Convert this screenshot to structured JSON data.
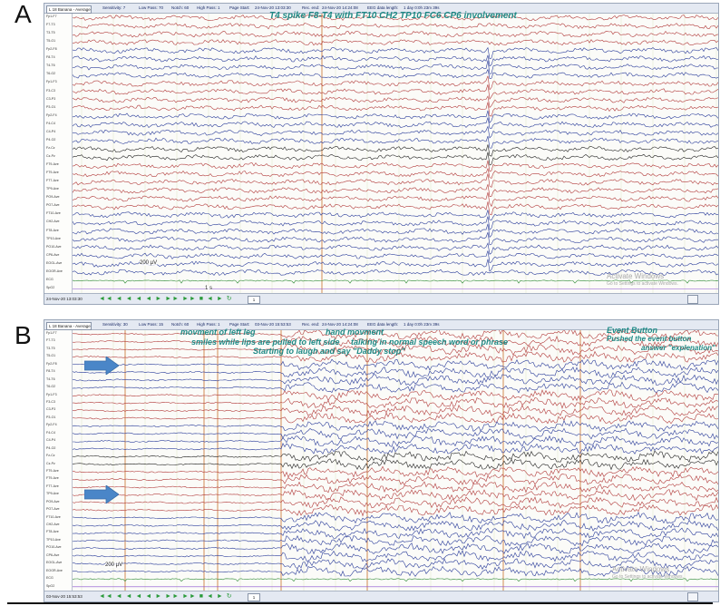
{
  "panels": [
    {
      "letter": "A",
      "toolbar": {
        "montage": "L 18 Banana - Average",
        "sensitivity": "Sensitivity: 7",
        "low_pass": "Low Pass: 70",
        "notch": "Notch: 60",
        "high_pass": "High Pass: 1",
        "page_start": "Page Start:",
        "start_time": "24-Nov-20 13:03:30",
        "rec_end": "Rec. end:",
        "end_time": "24-Nov-20 14:24:08",
        "data_length": "EEG data length:",
        "duration": "1 day 0:0h 23m 39s"
      },
      "channels": [
        "Fp1-F7",
        "F7-T3",
        "T3-T5",
        "T5-O1",
        "Fp2-F8",
        "F8-T4",
        "T4-T6",
        "T6-O2",
        "Fp1-F3",
        "F3-C3",
        "C3-P3",
        "P3-O1",
        "Fp2-F4",
        "F4-C4",
        "C4-P4",
        "P4-O2",
        "Fz-Cz",
        "Cz-Pz",
        "FT9-Ave",
        "FT9-Ave",
        "FT7-Ave",
        "TP9-Ave",
        "PO9-Ave",
        "PO7-Ave",
        "FT10-Ave",
        "CH2-Ave",
        "FT8-Ave",
        "TP10-Ave",
        "PO10-Ave",
        "CP6-Ave",
        "EOGL-Ave",
        "EOGR-Ave",
        "ECG",
        "SpO2"
      ],
      "annotation": "T4 spike F8-T4 with FT10 CH2 TP10 FC6 CP6 involvement",
      "scale": "200 µV",
      "time_scale": "1 s",
      "watermark_title": "Activate Windows",
      "watermark_sub": "Go to Settings to activate Windows.",
      "status_time": "24-Nov-20 13:03:30",
      "page_value": "1"
    },
    {
      "letter": "B",
      "toolbar": {
        "montage": "L 18 Banana - Average",
        "sensitivity": "Sensitivity: 30",
        "low_pass": "Low Pass: 15",
        "notch": "Notch: 60",
        "high_pass": "High Pass: 1",
        "page_start": "Page Start:",
        "start_time": "03-Nov-20 15:53:53",
        "rec_end": "Rec. end:",
        "end_time": "24-Nov-20 14:24:08",
        "data_length": "EEG data length:",
        "duration": "1 day 0:0h 23m 39s"
      },
      "channels": [
        "Fp1-F7",
        "F7-T3",
        "T3-T5",
        "T5-O1",
        "Fp2-F8",
        "F8-T4",
        "T4-T6",
        "T6-O2",
        "Fp1-F3",
        "F3-C3",
        "C3-P3",
        "P3-O1",
        "Fp2-F4",
        "F4-C4",
        "C4-P4",
        "P4-O2",
        "Fz-Cz",
        "Cz-Pz",
        "FT9-Ave",
        "FT9-Ave",
        "FT7-Ave",
        "TP9-Ave",
        "PO9-Ave",
        "PO7-Ave",
        "FT10-Ave",
        "CH2-Ave",
        "FT8-Ave",
        "TP10-Ave",
        "PO10-Ave",
        "CP6-Ave",
        "EOGL-Ave",
        "EOGR-Ave",
        "ECG",
        "SpO2"
      ],
      "annotations": {
        "movement_leg": "movment of left leg",
        "smiles": "smiles while lips are pulled to left side",
        "laughing": "Starting to laugh and say \"Daddy stop\"",
        "hand": "hand movment",
        "talking": "talking in normal speech  word or  phrase",
        "event_button": "Event Button",
        "pushed": "Pushed the event button",
        "answer": "answer  \"explenation\""
      },
      "scale": "200 µV",
      "watermark_title": "Activate Windows",
      "watermark_sub": "Go to Settings to activate Windows.",
      "status_time": "03-Nov-20 15:53:53",
      "page_value": "1"
    }
  ],
  "colors": {
    "red_trace": "#b23b3b",
    "blue_trace": "#2a3c9a",
    "black_trace": "#222222",
    "ecg_trace": "#2e8b35",
    "annotation": "#1f8a86",
    "arrow": "#4a86c8"
  }
}
